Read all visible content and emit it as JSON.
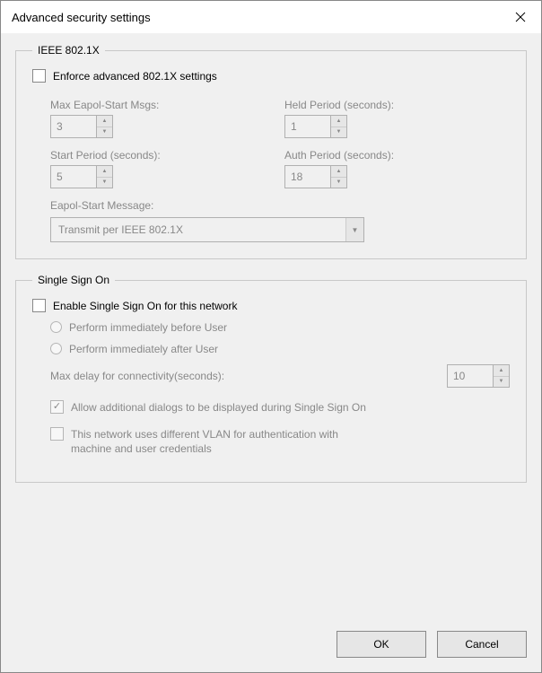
{
  "title": "Advanced security settings",
  "ieee": {
    "legend": "IEEE 802.1X",
    "enforce_label": "Enforce advanced 802.1X settings",
    "max_eapol_label": "Max Eapol-Start Msgs:",
    "max_eapol_value": "3",
    "held_label": "Held Period (seconds):",
    "held_value": "1",
    "start_label": "Start Period (seconds):",
    "start_value": "5",
    "auth_label": "Auth Period (seconds):",
    "auth_value": "18",
    "eapol_msg_label": "Eapol-Start Message:",
    "eapol_msg_value": "Transmit per IEEE 802.1X"
  },
  "sso": {
    "legend": "Single Sign On",
    "enable_label": "Enable Single Sign On for this network",
    "before_label": "Perform immediately before User",
    "after_label": "Perform immediately after User",
    "maxdelay_label": "Max delay for connectivity(seconds):",
    "maxdelay_value": "10",
    "allow_dialogs_label": "Allow additional dialogs to be displayed during Single Sign On",
    "vlan_label": "This network uses different VLAN for authentication with machine and user credentials"
  },
  "buttons": {
    "ok": "OK",
    "cancel": "Cancel"
  },
  "glyphs": {
    "check": "✓",
    "up": "▲",
    "down": "▼"
  }
}
